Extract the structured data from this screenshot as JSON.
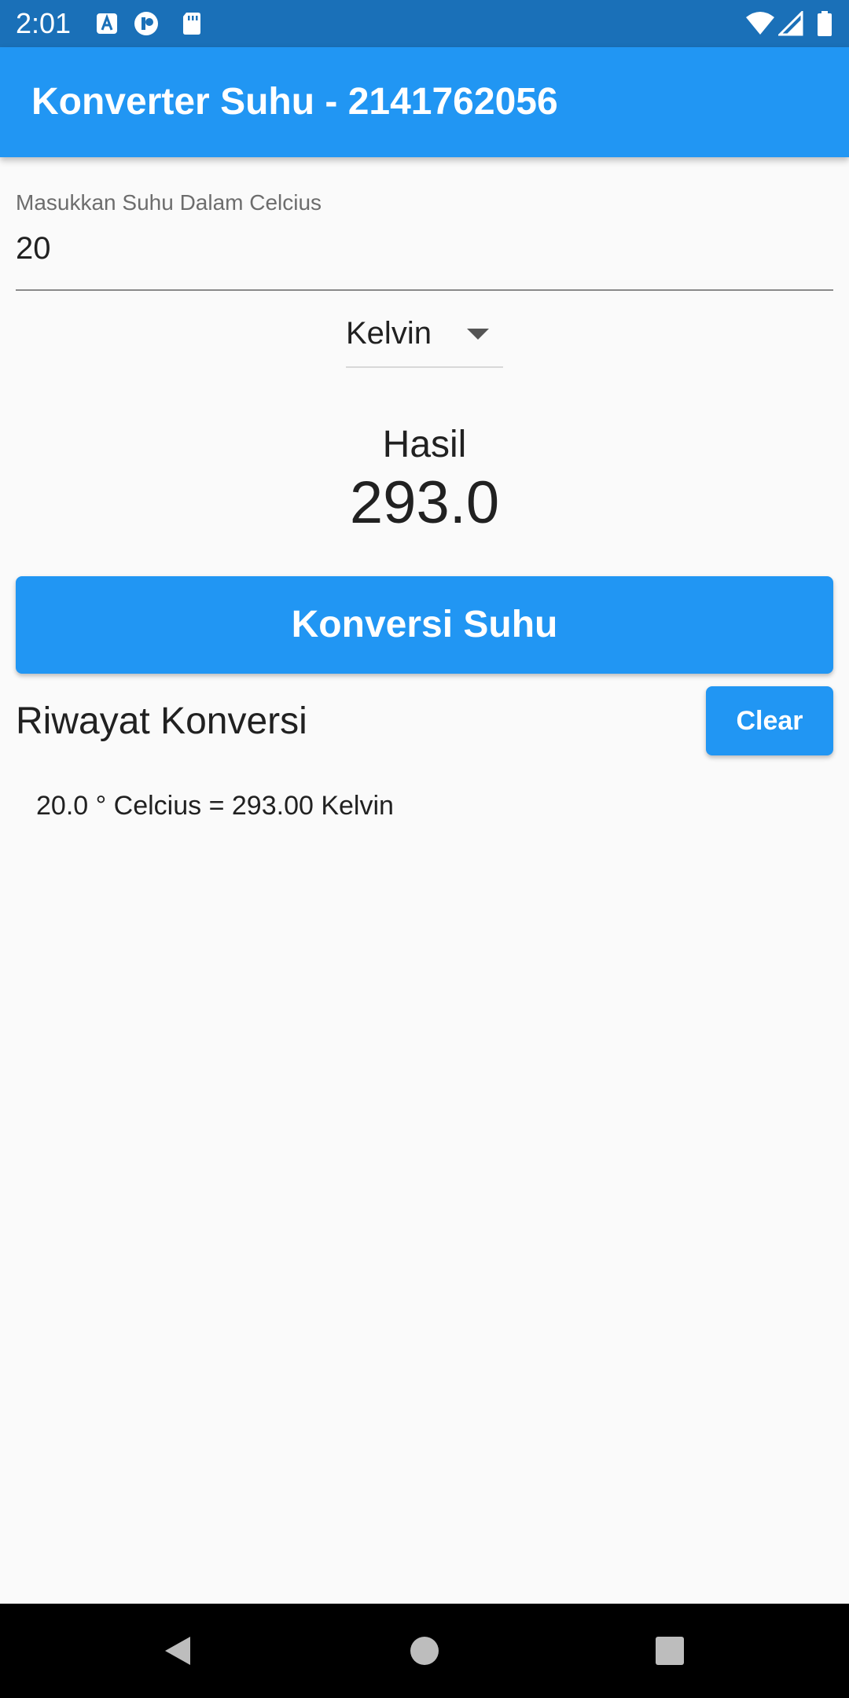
{
  "status_bar": {
    "time": "2:01",
    "left_icons": [
      "a-notification-icon",
      "record-icon",
      "sd-card-icon"
    ],
    "right_icons": [
      "wifi-icon",
      "signal-icon",
      "battery-icon"
    ]
  },
  "app_bar": {
    "title": "Konverter Suhu - 2141762056"
  },
  "input": {
    "label": "Masukkan Suhu Dalam Celcius",
    "value": "20"
  },
  "dropdown": {
    "selected": "Kelvin"
  },
  "result": {
    "label": "Hasil",
    "value": "293.0"
  },
  "convert_button": {
    "label": "Konversi Suhu"
  },
  "history": {
    "title": "Riwayat Konversi",
    "clear_label": "Clear",
    "items": [
      "20.0 ° Celcius = 293.00 Kelvin"
    ]
  },
  "nav_bar": {
    "buttons": [
      "back-icon",
      "home-icon",
      "recents-icon"
    ]
  },
  "colors": {
    "primary": "#2196f3",
    "status_bar": "#1a70b8",
    "background": "#fafafa"
  }
}
